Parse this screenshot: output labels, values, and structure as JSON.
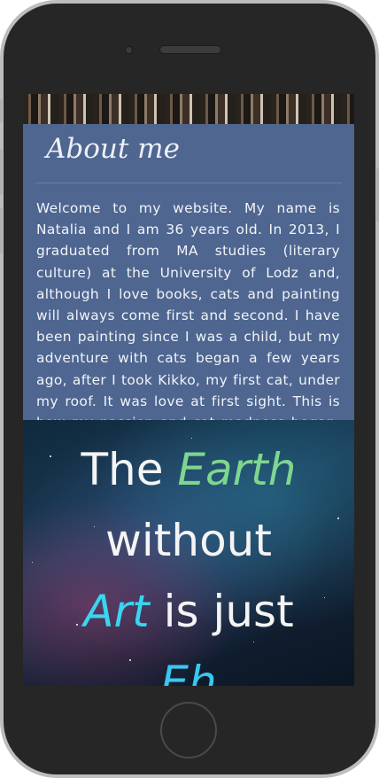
{
  "about": {
    "title": "About me",
    "bio": "Welcome to my website. My name is Natalia and I am 36 years old. In 2013, I graduated from MA studies (literary culture) at the University of Lodz and, although I love books, cats and painting will always come first and second. I have been painting since I was a child, but my adventure with cats began a few years ago, after I took Kikko, my first cat, under my roof. It was love at first sight. This is how my passion and cat madness began. Blind"
  },
  "quote": {
    "w1": "The ",
    "w2": "Earth",
    "w3": "without",
    "w4": "Art",
    "w5": " is just",
    "w6": "Eh"
  },
  "colors": {
    "panel": "#4e6690",
    "earth_accent": "#7fd68f",
    "art_accent": "#38d6f0"
  }
}
